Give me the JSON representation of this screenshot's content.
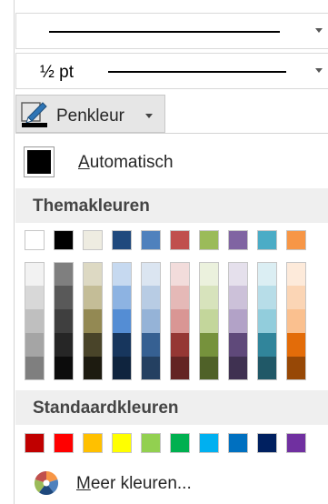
{
  "line_weight": {
    "value": "½ pt"
  },
  "pen_color": {
    "label": "Penkleur"
  },
  "automatic": {
    "prefix": "A",
    "rest": "utomatisch"
  },
  "theme_colors": {
    "title": "Themakleuren",
    "base": [
      "#ffffff",
      "#000000",
      "#eeece1",
      "#1f497d",
      "#4f81bd",
      "#c0504d",
      "#9bbb59",
      "#8064a2",
      "#4bacc6",
      "#f79646"
    ],
    "tints": [
      [
        "#f2f2f2",
        "#7f7f7f",
        "#ddd9c3",
        "#c6d9f0",
        "#dbe5f1",
        "#f2dcdb",
        "#ebf1dd",
        "#e5e0ec",
        "#dbeef3",
        "#fdeada"
      ],
      [
        "#d8d8d8",
        "#595959",
        "#c4bd97",
        "#8db3e2",
        "#b8cce4",
        "#e5b9b7",
        "#d7e3bc",
        "#ccc1d9",
        "#b7dde8",
        "#fbd5b5"
      ],
      [
        "#bfbfbf",
        "#3f3f3f",
        "#938953",
        "#548dd4",
        "#95b3d7",
        "#d99694",
        "#c3d69b",
        "#b2a2c7",
        "#92cddc",
        "#fac08f"
      ],
      [
        "#a5a5a5",
        "#262626",
        "#494429",
        "#17365d",
        "#366092",
        "#953734",
        "#76923c",
        "#5f497a",
        "#31859b",
        "#e36c09"
      ],
      [
        "#7f7f7f",
        "#0c0c0c",
        "#1d1b10",
        "#0f243e",
        "#244061",
        "#632423",
        "#4f6128",
        "#3f3151",
        "#205867",
        "#974806"
      ]
    ]
  },
  "standard_colors": {
    "title": "Standaardkleuren",
    "colors": [
      "#c00000",
      "#ff0000",
      "#ffc000",
      "#ffff00",
      "#92d050",
      "#00b050",
      "#00b0f0",
      "#0070c0",
      "#002060",
      "#7030a0"
    ]
  },
  "more_colors": {
    "prefix": "M",
    "rest": "eer kleuren..."
  },
  "icons": {
    "pen": "pen-color-icon",
    "palette": "color-palette-icon",
    "dropdown": "chevron-down-icon"
  }
}
